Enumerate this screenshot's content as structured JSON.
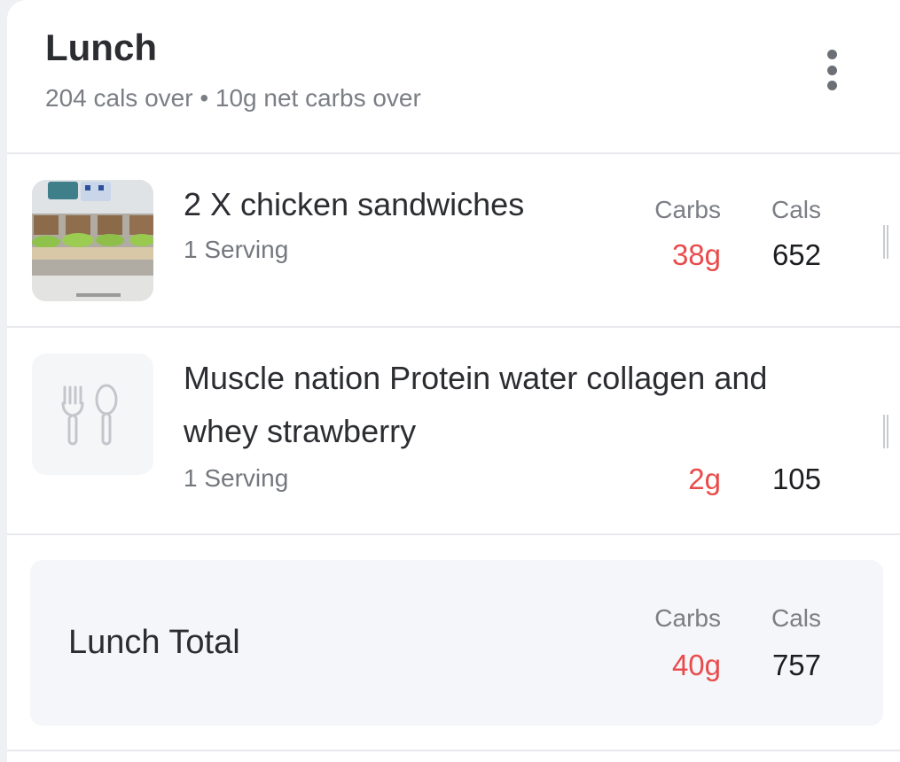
{
  "meal": {
    "title": "Lunch",
    "subtitle": "204 cals over • 10g net carbs over"
  },
  "columns": {
    "carbs_label": "Carbs",
    "cals_label": "Cals"
  },
  "items": [
    {
      "name": "2 X chicken sandwiches",
      "serving": "1 Serving",
      "carbs": "38g",
      "cals": "652",
      "icon": "food-photo"
    },
    {
      "name": "Muscle nation Protein water collagen and whey strawberry",
      "serving": "1 Serving",
      "carbs": "2g",
      "cals": "105",
      "icon": "fork-spoon-icon"
    }
  ],
  "total": {
    "label": "Lunch Total",
    "carbs": "40g",
    "cals": "757"
  },
  "colors": {
    "carbs": "#e94b4b",
    "text": "#2b2d31",
    "muted": "#7b7e84"
  }
}
